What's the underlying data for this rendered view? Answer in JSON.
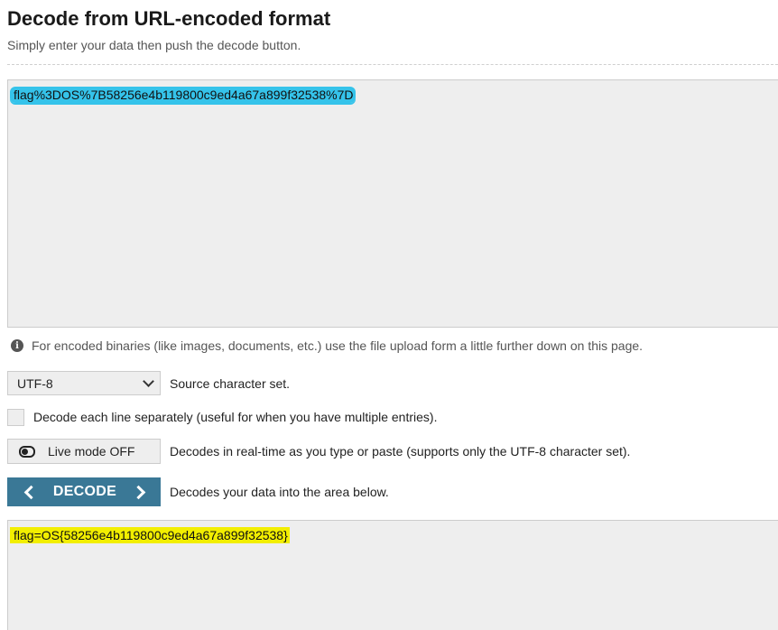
{
  "header": {
    "title": "Decode from URL-encoded format",
    "subtitle": "Simply enter your data then push the decode button."
  },
  "input": {
    "value": "flag%3DOS%7B58256e4b119800c9ed4a67a899f32538%7D",
    "highlight_color": "#35c3ea"
  },
  "info": {
    "icon": "info-circle-icon",
    "text": "For encoded binaries (like images, documents, etc.) use the file upload form a little further down on this page."
  },
  "options": {
    "charset": {
      "selected": "UTF-8",
      "label": "Source character set."
    },
    "each_line": {
      "checked": false,
      "label": "Decode each line separately (useful for when you have multiple entries)."
    },
    "live_mode": {
      "button_label": "Live mode OFF",
      "icon": "toggle-off-icon",
      "description": "Decodes in real-time as you type or paste (supports only the UTF-8 character set)."
    }
  },
  "decode": {
    "button_label": "DECODE",
    "description": "Decodes your data into the area below.",
    "button_color": "#3a7896"
  },
  "output": {
    "value": "flag=OS{58256e4b119800c9ed4a67a899f32538}",
    "highlight_color": "#f2ee00"
  }
}
